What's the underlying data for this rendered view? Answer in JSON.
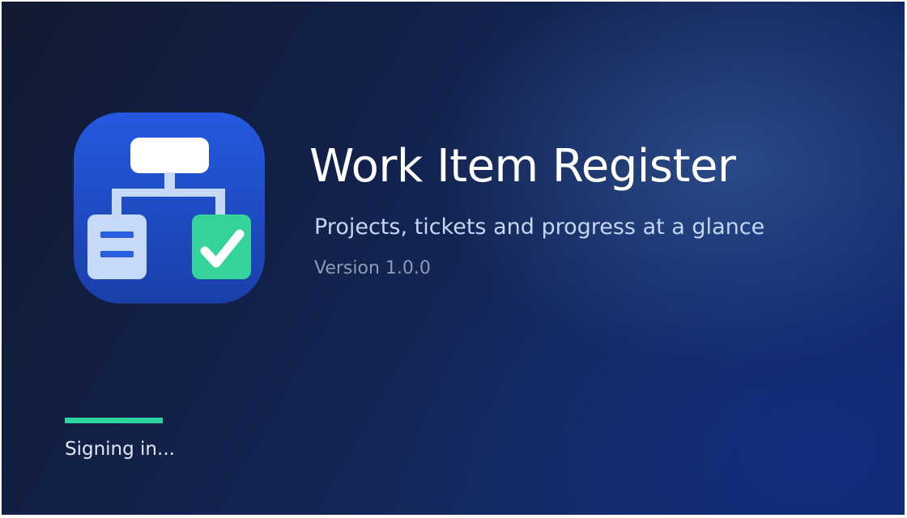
{
  "app": {
    "title": "Work Item Register",
    "tagline": "Projects, tickets and progress at a glance",
    "version": "Version 1.0.0",
    "icon": "workflow-check-icon"
  },
  "loading": {
    "status": "Signing in...",
    "progress": 1.0,
    "color": "#2fd3a0"
  },
  "colors": {
    "background": "#13214a",
    "icon_background": "#2052d0",
    "check_badge": "#34d399"
  }
}
